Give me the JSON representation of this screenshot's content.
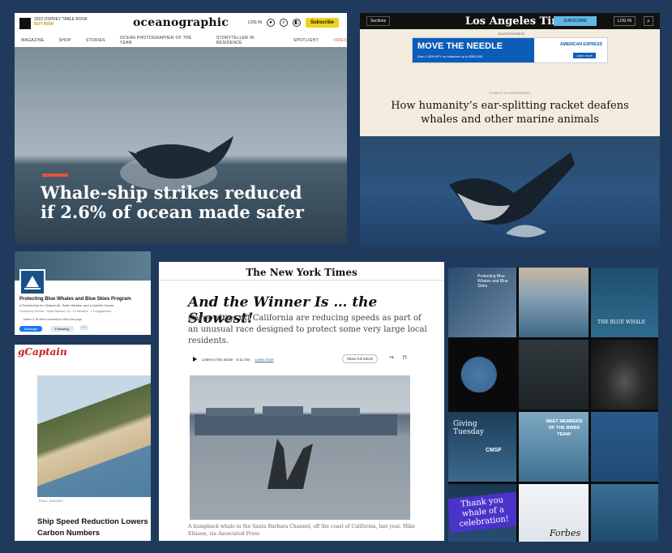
{
  "oceanographic": {
    "promo_top": "2022 OSPREY TABLE BOOK",
    "promo_bottom": "BUY NOW",
    "brand": "oceanographic",
    "login": "LOG IN",
    "subscribe": "Subscribe",
    "menu": [
      "MAGAZINE",
      "SHOP",
      "STORIES",
      "OCEAN PHOTOGRAPHER OF THE YEAR",
      "STORYTELLER IN RESIDENCE",
      "SPOTLIGHT",
      "VIDEO"
    ],
    "headline": "Whale-ship strikes reduced if 2.6% of ocean made safer"
  },
  "latimes": {
    "sections": "Sections",
    "brand": "Los Angeles Times",
    "subscribe": "SUBSCRIBE",
    "login": "LOG IN",
    "ad_label": "ADVERTISEMENT",
    "ad_title": "MOVE THE NEEDLE",
    "ad_small": "Earn 1.00% APY on balances up to $500,000",
    "ad_brand": "AMERICAN EXPRESS",
    "ad_learn": "Learn more",
    "kicker": "CLIMATE & ENVIRONMENT",
    "headline": "How humanity’s ear-splitting racket deafens whales and other marine animals"
  },
  "facebook": {
    "name": "Protecting Blue Whales and Blue Skies Program",
    "desc": "A Partnership for Cleaner Air, Safer Whales, and a Quieter Ocean",
    "meta": "Community Service · Santa Barbara, CA · 10 followers · 1.2 engagement",
    "likes": "Justine & 38 other connections follow this page",
    "message": "Message",
    "following": "Following",
    "more": "···"
  },
  "gcaptain": {
    "logo": "gCaptain",
    "credit": "Photo: BAAQMD",
    "headline": "Ship Speed Reduction Lowers Carbon Numbers"
  },
  "nyt": {
    "brand": "The New York Times",
    "headline": "And the Winner Is … the Slowest!",
    "dek": "Cargo ships off California are reducing speeds as part of an unusual race designed to protect some very large local residents.",
    "listen": "Listen to this article · 5:11 min",
    "learn": "Learn more",
    "share": "Share full article",
    "caption": "A humpback whale in the Santa Barbara Channel, off the coast of California, last year. Mike Eliason, via Associated Press"
  },
  "instagram": {
    "cell1": "Protecting Blue Whales and Blue Skies",
    "cell3": "THE BLUE WHALE",
    "cell5_text": "",
    "cell7": "Giving Tuesday",
    "cell7b": "CMSF",
    "cell8": "MEET MEMBERS OF THE BWBS TEAM!",
    "cell10": "Thank you whale of a celebration!",
    "cell11": "Forbes"
  },
  "colors": {
    "background": "#1f3a5c",
    "nyt_link": "#326891",
    "oceanographic_subscribe": "#f0d21a",
    "latimes_subscribe": "#5fb8e6",
    "facebook_blue": "#1877f2",
    "gcaptain_red": "#c41e1e"
  }
}
